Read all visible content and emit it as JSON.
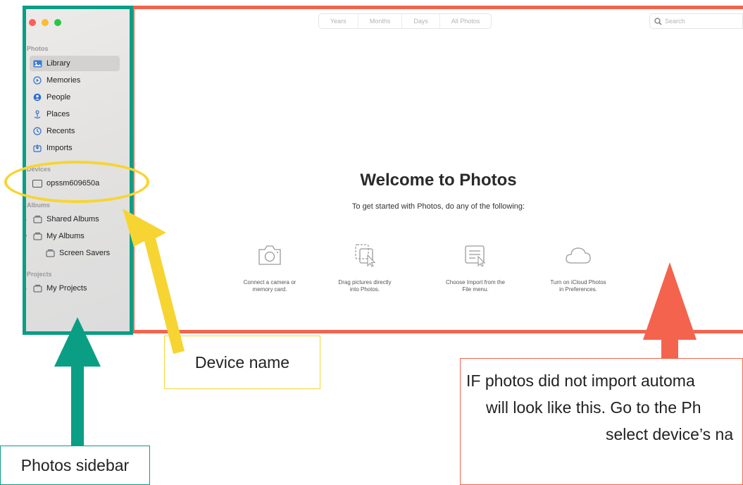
{
  "toolbar": {
    "segments": [
      "Years",
      "Months",
      "Days",
      "All Photos"
    ],
    "search_placeholder": "Search"
  },
  "sidebar": {
    "sections": {
      "photos": "Photos",
      "devices": "Devices",
      "albums": "Albums",
      "projects": "Projects"
    },
    "items": [
      {
        "label": "Library",
        "icon": "library-icon",
        "selected": true
      },
      {
        "label": "Memories",
        "icon": "memories-icon"
      },
      {
        "label": "People",
        "icon": "people-icon"
      },
      {
        "label": "Places",
        "icon": "places-icon"
      },
      {
        "label": "Recents",
        "icon": "recents-icon"
      },
      {
        "label": "Imports",
        "icon": "imports-icon"
      }
    ],
    "device": {
      "label": "opssm609650a",
      "icon": "device-icon"
    },
    "albums": [
      {
        "label": "Shared Albums",
        "icon": "shared-albums-icon"
      },
      {
        "label": "My Albums",
        "icon": "folder-icon"
      },
      {
        "label": "Screen Savers",
        "icon": "album-icon"
      }
    ],
    "projects": [
      {
        "label": "My Projects",
        "icon": "folder-icon"
      }
    ]
  },
  "welcome": {
    "title": "Welcome to Photos",
    "subtitle": "To get started with Photos, do any of the following:",
    "options": [
      {
        "line1": "Connect a camera or",
        "line2": "memory card.",
        "icon": "camera-icon"
      },
      {
        "line1": "Drag pictures directly",
        "line2": "into Photos.",
        "icon": "drag-icon"
      },
      {
        "line1": "Choose Import from the",
        "line2": "File menu.",
        "icon": "file-menu-icon"
      },
      {
        "line1": "Turn on iCloud Photos",
        "line2": "in Preferences.",
        "icon": "icloud-icon"
      }
    ]
  },
  "annotations": {
    "device_name": "Device name",
    "photos_sidebar": "Photos sidebar",
    "red_note_line1": "IF photos did not import automa",
    "red_note_line2": "will look like this.  Go to the Ph",
    "red_note_line3": "select device’s na"
  },
  "colors": {
    "teal": "#0a9e85",
    "red": "#f4634e",
    "yellow": "#f6d533"
  }
}
